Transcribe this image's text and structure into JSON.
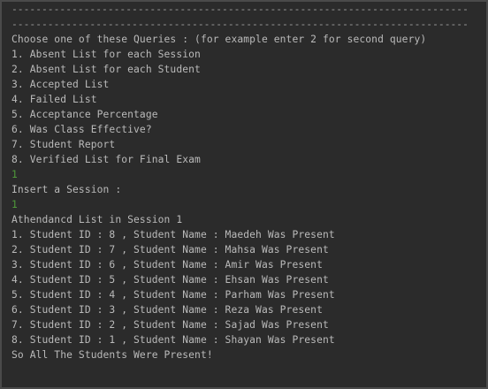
{
  "console": {
    "lines": [
      {
        "text": "----------------------------------------------------------------------------",
        "kind": "sep"
      },
      {
        "text": "----------------------------------------------------------------------------",
        "kind": "sep"
      },
      {
        "text": "Choose one of these Queries : (for example enter 2 for second query)",
        "kind": "output"
      },
      {
        "text": "1. Absent List for each Session",
        "kind": "output"
      },
      {
        "text": "2. Absent List for each Student",
        "kind": "output"
      },
      {
        "text": "3. Accepted List",
        "kind": "output"
      },
      {
        "text": "4. Failed List",
        "kind": "output"
      },
      {
        "text": "5. Acceptance Percentage",
        "kind": "output"
      },
      {
        "text": "6. Was Class Effective?",
        "kind": "output"
      },
      {
        "text": "7. Student Report",
        "kind": "output"
      },
      {
        "text": "8. Verified List for Final Exam",
        "kind": "output"
      },
      {
        "text": "1",
        "kind": "input"
      },
      {
        "text": "Insert a Session :",
        "kind": "output"
      },
      {
        "text": "1",
        "kind": "input"
      },
      {
        "text": "Athendancd List in Session 1",
        "kind": "output"
      },
      {
        "text": "1. Student ID : 8 , Student Name : Maedeh Was Present",
        "kind": "output"
      },
      {
        "text": "2. Student ID : 7 , Student Name : Mahsa Was Present",
        "kind": "output"
      },
      {
        "text": "3. Student ID : 6 , Student Name : Amir Was Present",
        "kind": "output"
      },
      {
        "text": "4. Student ID : 5 , Student Name : Ehsan Was Present",
        "kind": "output"
      },
      {
        "text": "5. Student ID : 4 , Student Name : Parham Was Present",
        "kind": "output"
      },
      {
        "text": "6. Student ID : 3 , Student Name : Reza Was Present",
        "kind": "output"
      },
      {
        "text": "7. Student ID : 2 , Student Name : Sajad Was Present",
        "kind": "output"
      },
      {
        "text": "8. Student ID : 1 , Student Name : Shayan Was Present",
        "kind": "output"
      },
      {
        "text": "So All The Students Were Present!",
        "kind": "output"
      }
    ]
  },
  "colors": {
    "background": "#2b2b2b",
    "output_text": "#bababa",
    "input_text": "#4f9a3a"
  }
}
